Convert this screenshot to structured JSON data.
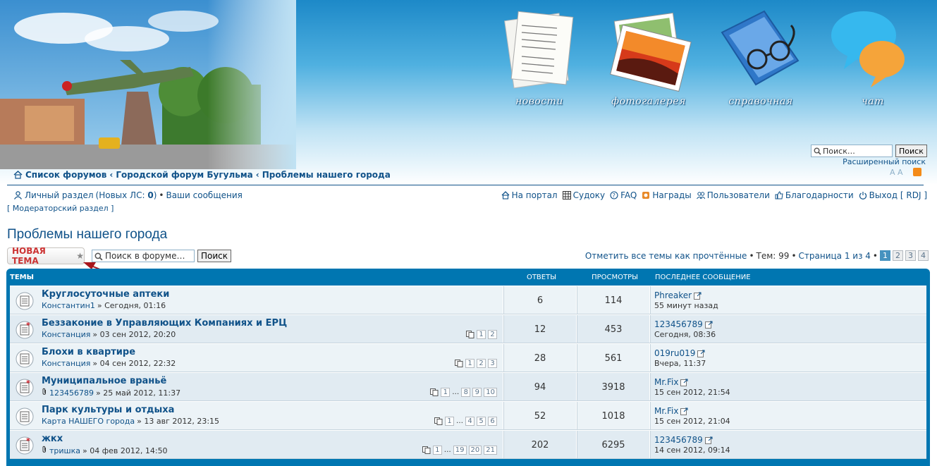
{
  "header": {
    "nav": [
      {
        "label": "новости",
        "icon": "news-papers-icon"
      },
      {
        "label": "фотогалерея",
        "icon": "photo-gallery-icon"
      },
      {
        "label": "справочная",
        "icon": "reference-book-icon"
      },
      {
        "label": "чат",
        "icon": "chat-bubbles-icon"
      }
    ],
    "search_placeholder": "Поиск…",
    "search_button": "Поиск",
    "advanced_search": "Расширенный поиск",
    "font_size_label": "A A"
  },
  "breadcrumb": [
    "Список форумов",
    "Городской форум Бугульма",
    "Проблемы нашего города"
  ],
  "breadcrumb_sep": "‹",
  "userbar": {
    "personal": "Личный раздел",
    "new_pm_prefix": "(Новых ЛС:",
    "new_pm_count": "0",
    "new_pm_suffix": ")",
    "bullet": "•",
    "your_posts": "Ваши сообщения",
    "moderator": "[ Модераторский раздел ]"
  },
  "navlinks": [
    {
      "label": "На портал",
      "icon": "home-icon"
    },
    {
      "label": "Судоку",
      "icon": "grid-icon"
    },
    {
      "label": "FAQ",
      "icon": "faq-icon"
    },
    {
      "label": "Награды",
      "icon": "award-icon"
    },
    {
      "label": "Пользователи",
      "icon": "users-icon"
    },
    {
      "label": "Благодарности",
      "icon": "thumbs-up-icon"
    },
    {
      "label": "Выход [ RDJ ]",
      "icon": "power-icon"
    }
  ],
  "page_title": "Проблемы нашего города",
  "actions": {
    "new_topic": "НОВАЯ ТЕМА",
    "forum_search_placeholder": "Поиск в форуме…",
    "forum_search_button": "Поиск",
    "mark_read": "Отметить все темы как прочтённые",
    "topics_count": "Тем: 99",
    "page_of": "Страница 1 из 4",
    "pages": [
      "1",
      "2",
      "3",
      "4"
    ]
  },
  "table": {
    "headers": {
      "topics": "ТЕМЫ",
      "replies": "ОТВЕТЫ",
      "views": "ПРОСМОТРЫ",
      "last_post": "ПОСЛЕДНЕЕ СООБЩЕНИЕ"
    },
    "rows": [
      {
        "title": "Круглосуточные аптеки",
        "author": "Константин1",
        "date": "» Сегодня, 01:16",
        "attach": false,
        "hot": false,
        "pages": [],
        "replies": "6",
        "views": "114",
        "last_author": "Phreaker",
        "last_time": "55 минут назад"
      },
      {
        "title": "Беззаконие в Управляющих Компаниях и ЕРЦ",
        "author": "Констанция",
        "date": "» 03 сен 2012, 20:20",
        "attach": false,
        "hot": true,
        "pages": [
          "1",
          "2"
        ],
        "replies": "12",
        "views": "453",
        "last_author": "123456789",
        "last_time": "Сегодня, 08:36"
      },
      {
        "title": "Блохи в квартире",
        "author": "Констанция",
        "date": "» 04 сен 2012, 22:32",
        "attach": false,
        "hot": false,
        "pages": [
          "1",
          "2",
          "3"
        ],
        "replies": "28",
        "views": "561",
        "last_author": "019ru019",
        "last_time": "Вчера, 11:37"
      },
      {
        "title": "Муниципальное враньё",
        "author": "123456789",
        "date": "» 25 май 2012, 11:37",
        "attach": true,
        "hot": true,
        "pages": [
          "1",
          "…",
          "8",
          "9",
          "10"
        ],
        "replies": "94",
        "views": "3918",
        "last_author": "Mr.Fix",
        "last_time": "15 сен 2012, 21:54"
      },
      {
        "title": "Парк культуры и отдыха",
        "author": "Карта НАШЕГО города",
        "date": "» 13 авг 2012, 23:15",
        "attach": false,
        "hot": false,
        "pages": [
          "1",
          "…",
          "4",
          "5",
          "6"
        ],
        "replies": "52",
        "views": "1018",
        "last_author": "Mr.Fix",
        "last_time": "15 сен 2012, 21:04"
      },
      {
        "title": "жкх",
        "author": "тришка",
        "date": "» 04 фев 2012, 14:50",
        "attach": true,
        "hot": true,
        "pages": [
          "1",
          "…",
          "19",
          "20",
          "21"
        ],
        "replies": "202",
        "views": "6295",
        "last_author": "123456789",
        "last_time": "14 сен 2012, 09:14"
      }
    ]
  }
}
